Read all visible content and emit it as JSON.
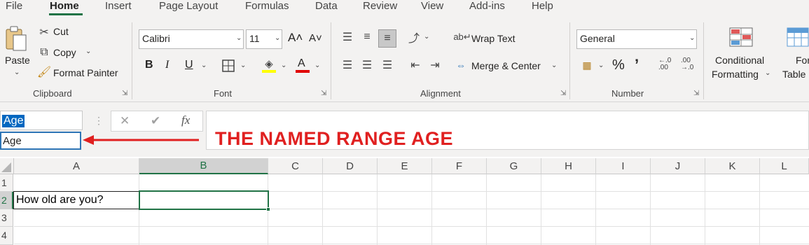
{
  "tabs": [
    "File",
    "Home",
    "Insert",
    "Page Layout",
    "Formulas",
    "Data",
    "Review",
    "View",
    "Add-ins",
    "Help"
  ],
  "ribbon": {
    "clipboard": {
      "paste_label": "Paste",
      "cut_label": "Cut",
      "copy_label": "Copy",
      "format_painter_label": "Format Painter",
      "group_label": "Clipboard"
    },
    "font": {
      "family": "Calibri",
      "size": "11",
      "grow_label": "A˄",
      "shrink_label": "A˅",
      "bold": "B",
      "italic": "I",
      "underline": "U",
      "group_label": "Font"
    },
    "alignment": {
      "wrap_text_label": "Wrap Text",
      "merge_center_label": "Merge & Center",
      "group_label": "Alignment"
    },
    "number": {
      "format": "General",
      "percent": "%",
      "comma": "’",
      "inc_decimal": "←.0 .00",
      "dec_decimal": ".00 →.0",
      "group_label": "Number"
    },
    "styles": {
      "conditional_label_1": "Conditional",
      "conditional_label_2": "Formatting",
      "format_table_label_1": "Format",
      "format_table_label_2": "Table"
    }
  },
  "formula_bar": {
    "name_box_value": "Age",
    "dropdown_item": "Age",
    "cancel_symbol": "✕",
    "enter_symbol": "✔",
    "fx_symbol": "fx",
    "formula_value": ""
  },
  "annotation": "THE NAMED RANGE AGE",
  "grid": {
    "columns": [
      "A",
      "B",
      "C",
      "D",
      "E",
      "F",
      "G",
      "H",
      "I",
      "J",
      "K",
      "L"
    ],
    "rows": [
      "1",
      "2",
      "3",
      "4"
    ],
    "cells": {
      "A2": "How old are you?"
    }
  },
  "colors": {
    "accent_green": "#217346",
    "annotation_red": "#e02020",
    "selection_blue": "#0067c0"
  }
}
